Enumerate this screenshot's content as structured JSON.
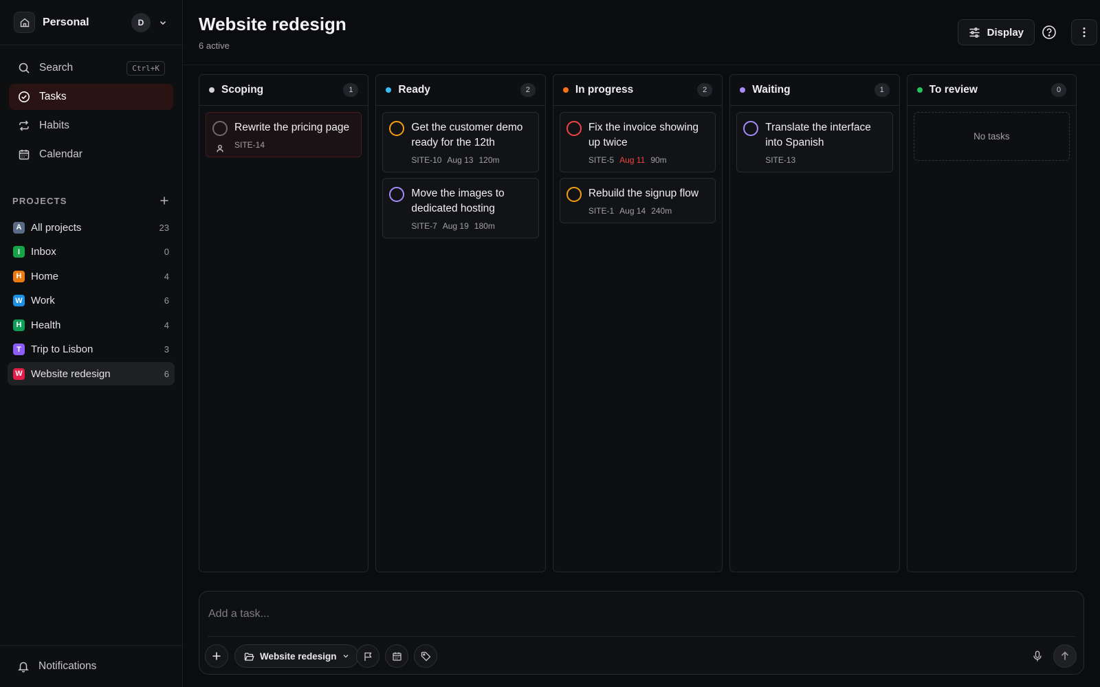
{
  "workspace": {
    "name": "Personal",
    "avatar": "D"
  },
  "nav": {
    "search_label": "Search",
    "search_shortcut": "Ctrl+K",
    "tasks_label": "Tasks",
    "habits_label": "Habits",
    "calendar_label": "Calendar"
  },
  "projects": {
    "heading": "PROJECTS",
    "items": [
      {
        "letter": "A",
        "label": "All projects",
        "count": "23",
        "color": "#5b6b86"
      },
      {
        "letter": "I",
        "label": "Inbox",
        "count": "0",
        "color": "#16a34a"
      },
      {
        "letter": "H",
        "label": "Home",
        "count": "4",
        "color": "#ea7a12"
      },
      {
        "letter": "W",
        "label": "Work",
        "count": "6",
        "color": "#1d8fe0"
      },
      {
        "letter": "H",
        "label": "Health",
        "count": "4",
        "color": "#0f9d58"
      },
      {
        "letter": "T",
        "label": "Trip to Lisbon",
        "count": "3",
        "color": "#8b5cf6"
      },
      {
        "letter": "W",
        "label": "Website redesign",
        "count": "6",
        "color": "#e11d48"
      }
    ]
  },
  "notifications_label": "Notifications",
  "header": {
    "title": "Website redesign",
    "subtitle": "6 active",
    "display_label": "Display"
  },
  "columns": [
    {
      "title": "Scoping",
      "count": "1",
      "dot_color": "#d4d4d8",
      "cards": [
        {
          "title": "Rewrite the pricing page",
          "id": "SITE-14",
          "date": "",
          "duration": "",
          "circle_color": "#6b6b70"
        }
      ]
    },
    {
      "title": "Ready",
      "count": "2",
      "dot_color": "#38bdf8",
      "cards": [
        {
          "title": "Get the customer demo ready for the 12th",
          "id": "SITE-10",
          "date": "Aug 13",
          "duration": "120m",
          "circle_color": "#f59e0b"
        },
        {
          "title": "Move the images to dedicated hosting",
          "id": "SITE-7",
          "date": "Aug 19",
          "duration": "180m",
          "circle_color": "#a78bfa"
        }
      ]
    },
    {
      "title": "In progress",
      "count": "2",
      "dot_color": "#f97316",
      "cards": [
        {
          "title": "Fix the invoice showing up twice",
          "id": "SITE-5",
          "date": "Aug 11",
          "duration": "90m",
          "circle_color": "#ef4444"
        },
        {
          "title": "Rebuild the signup flow",
          "id": "SITE-1",
          "date": "Aug 14",
          "duration": "240m",
          "circle_color": "#f59e0b"
        }
      ]
    },
    {
      "title": "Waiting",
      "count": "1",
      "dot_color": "#a78bfa",
      "cards": [
        {
          "title": "Translate the interface into Spanish",
          "id": "SITE-13",
          "date": "",
          "duration": "",
          "circle_color": "#a78bfa"
        }
      ]
    },
    {
      "title": "To review",
      "count": "0",
      "dot_color": "#22c55e",
      "empty_label": "No tasks",
      "cards": []
    }
  ],
  "composer": {
    "placeholder": "Add a task...",
    "project_label": "Website redesign"
  },
  "colors": {
    "accent_active": "#2a1313",
    "overdue": "#ef4444"
  }
}
